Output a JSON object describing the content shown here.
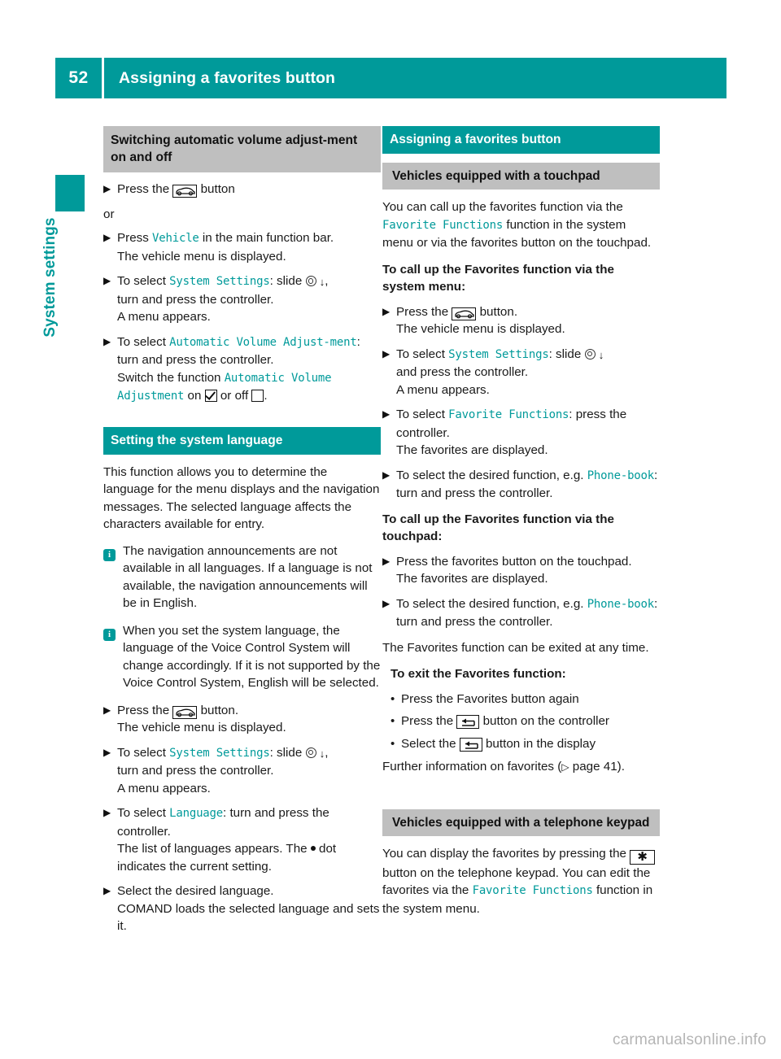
{
  "header": {
    "page_number": "52",
    "title": "Assigning a favorites button"
  },
  "sidebar": {
    "chapter_label": "System settings"
  },
  "icons": {
    "vehicle_button": "vehicle-car-button-icon",
    "controller": "controller-slide-icon",
    "arrow_down": "arrow-down-icon",
    "checkbox_on": "checkbox-checked-icon",
    "checkbox_off": "checkbox-unchecked-icon",
    "back_button": "back-arrow-button-icon",
    "star_button": "star-key-button-icon",
    "info": "info-icon",
    "bullet_dot": "radio-dot-icon",
    "page_ref": "page-reference-arrow-icon",
    "star_glyph": "✱",
    "info_glyph": "i",
    "step_glyph": "▶",
    "bullet_glyph": "•",
    "arrow_down_glyph": "↓",
    "page_ref_glyph": "▷"
  },
  "left_column": {
    "section1": {
      "heading": "Switching automatic volume adjust-ment on and off",
      "steps": [
        {
          "pre": "Press the ",
          "icon": "vehicle_button",
          "post": " button"
        }
      ],
      "or_label": "or",
      "step_vehicle": {
        "pre": "Press ",
        "ui": "Vehicle",
        "post": " in the main function bar.",
        "result": "The vehicle menu is displayed."
      },
      "step_system_settings": {
        "pre": "To select ",
        "ui": "System Settings",
        "mid": ": slide ",
        "post": ",",
        "line2": "turn and press the controller.",
        "line3": "A menu appears."
      },
      "step_avolume": {
        "pre": "To select ",
        "ui1": "Automatic Volume Adjust-ment",
        "mid": ": turn and press the controller.",
        "line2_pre": "Switch the function ",
        "ui2": "Automatic Volume Adjustment",
        "line2_mid": " on ",
        "line2_or": " or off ",
        "line2_end": "."
      }
    },
    "section2": {
      "heading": "Setting the system language",
      "intro": "This function allows you to determine the language for the menu displays and the navigation messages. The selected language affects the characters available for entry.",
      "note1": "The navigation announcements are not available in all languages. If a language is not available, the navigation announcements will be in English.",
      "note2": "When you set the system language, the language of the Voice Control System will change accordingly. If it is not supported by the Voice Control System, English will be selected.",
      "step_press": {
        "pre": "Press the ",
        "post": " button.",
        "result": "The vehicle menu is displayed."
      },
      "step_system_settings": {
        "pre": "To select ",
        "ui": "System Settings",
        "mid": ": slide ",
        "post": ",",
        "line2": "turn and press the controller.",
        "line3": "A menu appears."
      },
      "step_language": {
        "pre": "To select ",
        "ui": "Language",
        "post": ": turn and press the",
        "line2": "controller.",
        "line3_pre": "The list of languages appears. The ",
        "line3_post": " dot indicates the current setting."
      },
      "step_select": {
        "line1": "Select the desired language.",
        "line2": "COMAND loads the selected language and sets it."
      }
    }
  },
  "right_column": {
    "heading": "Assigning a favorites button",
    "touchpad_section": {
      "subheading": "Vehicles equipped with a touchpad",
      "intro_pre": "You can call up the favorites function via the ",
      "intro_ui": "Favorite Functions",
      "intro_post": " function in the system menu or via the favorites button on the touchpad.",
      "call_up_heading": "To call up the Favorites function via the system menu:",
      "step_press": {
        "pre": "Press the ",
        "post": " button.",
        "result": "The vehicle menu is displayed."
      },
      "step_system_settings": {
        "pre": "To select ",
        "ui": "System Settings",
        "mid": ": slide ",
        "line2": "and press the controller.",
        "line3": "A menu appears."
      },
      "step_favorite_functions": {
        "pre": "To select ",
        "ui": "Favorite Functions",
        "post": ": press the controller.",
        "result": "The favorites are displayed."
      },
      "step_desired_function": {
        "pre": "To select the desired function, e.g. ",
        "ui": "Phone-book",
        "post": ": turn and press the controller."
      },
      "touchpad_heading": "To call up the Favorites function via the touchpad:",
      "step_press_fav": {
        "line1": "Press the favorites button on the touchpad.",
        "line2": "The favorites are displayed."
      },
      "step_desired_function2": {
        "pre": "To select the desired function, e.g. ",
        "ui": "Phone-book",
        "post": ": turn and press the controller."
      },
      "exit_note": "The Favorites function can be exited at any time.",
      "exit_heading": "To exit the Favorites function:",
      "exit_bullets": [
        {
          "text": "Press the Favorites button again",
          "icon": null
        },
        {
          "pre": "Press the ",
          "icon": "back_button",
          "post": " button on the controller"
        },
        {
          "pre": "Select the ",
          "icon": "back_button",
          "post": " button in the display"
        }
      ],
      "further_info_pre": "Further information on favorites (",
      "further_info_post": " page 41)."
    },
    "keypad_section": {
      "subheading": "Vehicles equipped with a telephone keypad",
      "text_pre": "You can display the favorites by pressing the ",
      "text_mid": " button on the telephone keypad. You can edit the favorites via the ",
      "text_ui": "Favorite Functions",
      "text_post": " function in the system menu."
    }
  },
  "watermark": "carmanualsonline.info",
  "colors": {
    "teal": "#009a9a",
    "gray": "#bfbfbf",
    "text": "#1a1a1a",
    "watermark": "#b5b5b5"
  }
}
